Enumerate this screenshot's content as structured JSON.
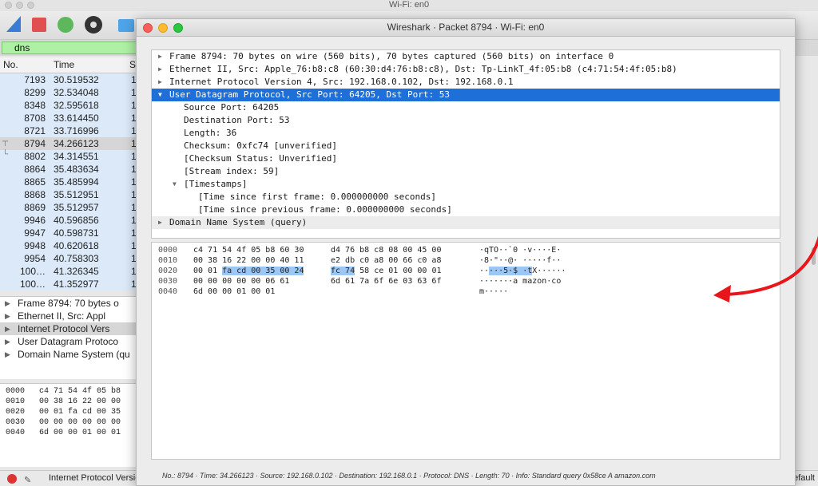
{
  "main_window": {
    "title": "Wi-Fi: en0",
    "filter": {
      "value": "dns"
    },
    "packet_list": {
      "columns": [
        "No.",
        "Time",
        "S"
      ],
      "rows": [
        {
          "no": "7193",
          "time": "30.519532",
          "s": "1"
        },
        {
          "no": "8299",
          "time": "32.534048",
          "s": "1"
        },
        {
          "no": "8348",
          "time": "32.595618",
          "s": "1"
        },
        {
          "no": "8708",
          "time": "33.614450",
          "s": "1"
        },
        {
          "no": "8721",
          "time": "33.716996",
          "s": "1"
        },
        {
          "no": "8794",
          "time": "34.266123",
          "s": "1",
          "selected": true
        },
        {
          "no": "8802",
          "time": "34.314551",
          "s": "1"
        },
        {
          "no": "8864",
          "time": "35.483634",
          "s": "1"
        },
        {
          "no": "8865",
          "time": "35.485994",
          "s": "1"
        },
        {
          "no": "8868",
          "time": "35.512951",
          "s": "1"
        },
        {
          "no": "8869",
          "time": "35.512957",
          "s": "1"
        },
        {
          "no": "9946",
          "time": "40.596856",
          "s": "1"
        },
        {
          "no": "9947",
          "time": "40.598731",
          "s": "1"
        },
        {
          "no": "9948",
          "time": "40.620618",
          "s": "1"
        },
        {
          "no": "9954",
          "time": "40.758303",
          "s": "1"
        },
        {
          "no": "100…",
          "time": "41.326345",
          "s": "1"
        },
        {
          "no": "100…",
          "time": "41.352977",
          "s": "1"
        }
      ]
    },
    "detail_rows": [
      "Frame 8794: 70 bytes o",
      "Ethernet II, Src: Appl",
      "Internet Protocol Vers",
      "User Datagram Protoco",
      "Domain Name System (qu"
    ],
    "hex_rows": [
      {
        "offset": "0000",
        "bytes": "c4 71 54 4f 05 b8"
      },
      {
        "offset": "0010",
        "bytes": "00 38 16 22 00 00"
      },
      {
        "offset": "0020",
        "bytes": "00 01 fa cd 00 35"
      },
      {
        "offset": "0030",
        "bytes": "00 00 00 00 00 00"
      },
      {
        "offset": "0040",
        "bytes": "6d 00 00 01 00 01"
      }
    ],
    "status": {
      "text": "Internet Protocol Versio",
      "right": "efault"
    }
  },
  "dialog": {
    "title": "Wireshark · Packet 8794 · Wi-Fi: en0",
    "tree": [
      {
        "text": "Frame 8794: 70 bytes on wire (560 bits), 70 bytes captured (560 bits) on interface 0",
        "level": 0,
        "toggle": "closed"
      },
      {
        "text": "Ethernet II, Src: Apple_76:b8:c8 (60:30:d4:76:b8:c8), Dst: Tp-LinkT_4f:05:b8 (c4:71:54:4f:05:b8)",
        "level": 0,
        "toggle": "closed"
      },
      {
        "text": "Internet Protocol Version 4, Src: 192.168.0.102, Dst: 192.168.0.1",
        "level": 0,
        "toggle": "closed"
      },
      {
        "text": "User Datagram Protocol, Src Port: 64205, Dst Port: 53",
        "level": 0,
        "toggle": "open",
        "selected": true
      },
      {
        "text": "Source Port: 64205",
        "level": 1,
        "toggle": "none"
      },
      {
        "text": "Destination Port: 53",
        "level": 1,
        "toggle": "none"
      },
      {
        "text": "Length: 36",
        "level": 1,
        "toggle": "none"
      },
      {
        "text": "Checksum: 0xfc74 [unverified]",
        "level": 1,
        "toggle": "none"
      },
      {
        "text": "[Checksum Status: Unverified]",
        "level": 1,
        "toggle": "none"
      },
      {
        "text": "[Stream index: 59]",
        "level": 1,
        "toggle": "none"
      },
      {
        "text": "[Timestamps]",
        "level": 1,
        "toggle": "open"
      },
      {
        "text": "[Time since first frame: 0.000000000 seconds]",
        "level": 2,
        "toggle": "none"
      },
      {
        "text": "[Time since previous frame: 0.000000000 seconds]",
        "level": 2,
        "toggle": "none"
      },
      {
        "text": "Domain Name System (query)",
        "level": 0,
        "toggle": "closed",
        "shaded": true
      }
    ],
    "hex": [
      {
        "offset": "0000",
        "b1": "c4 71 54 4f 05 b8 60 30",
        "b2": "d4 76 b8 c8 08 00 45 00",
        "ascii": "·qTO··`0 ·v····E·"
      },
      {
        "offset": "0010",
        "b1": "00 38 16 22 00 00 40 11",
        "b2": "e2 db c0 a8 00 66 c0 a8",
        "ascii": "·8·\"··@· ·····f··"
      },
      {
        "offset": "0020",
        "b1": "00 01 ",
        "b1_hl": "fa cd 00 35 00 24",
        "b2_hl": "fc 74",
        "b2": " 58 ce 01 00 00 01",
        "ascii": "··",
        "ascii_hl": "···5·$ ·t",
        "ascii_tail": "X······"
      },
      {
        "offset": "0030",
        "b1": "00 00 00 00 00 06 61",
        "b2": "6d 61 7a 6f 6e 03 63 6f",
        "ascii": "·······a mazon·co"
      },
      {
        "offset": "0040",
        "b1": "6d 00 00 01 00 01",
        "b2": "",
        "ascii": "m·····"
      }
    ],
    "status": "No.: 8794 · Time: 34.266123 · Source: 192.168.0.102 · Destination: 192.168.0.1 · Protocol: DNS · Length: 70 · Info: Standard query 0x58ce A amazon.com",
    "annotation_color": "#e8161b",
    "selection_color": "#1f6fd8"
  }
}
